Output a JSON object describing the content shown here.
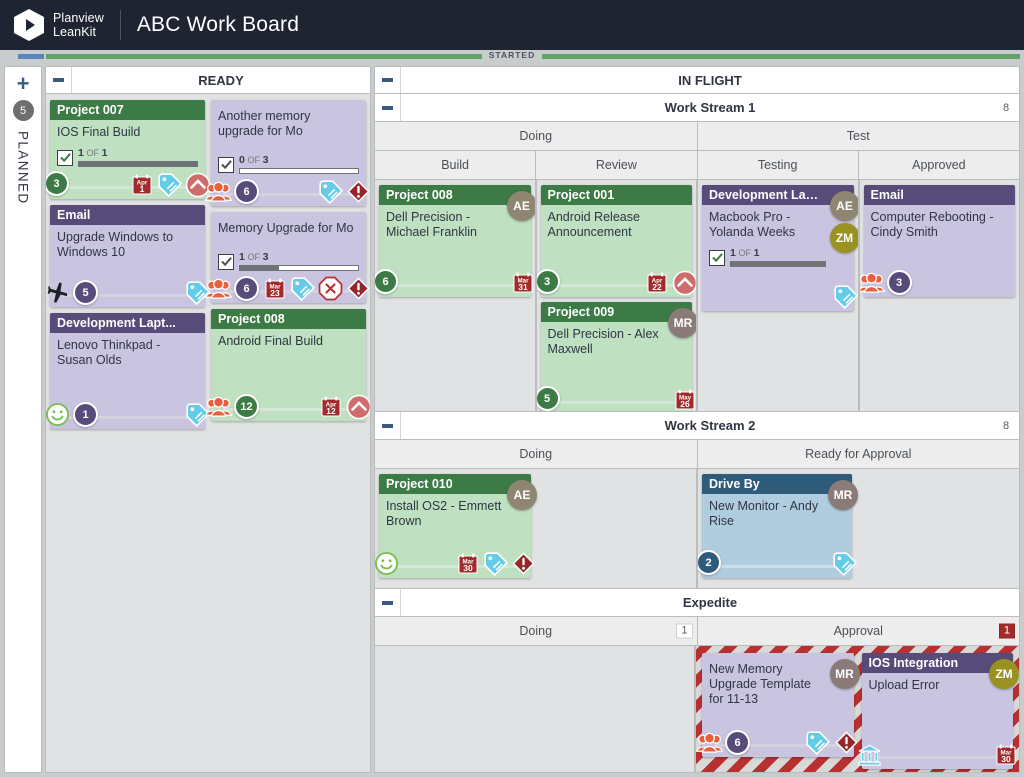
{
  "header": {
    "logo_line1": "Planview",
    "logo_line2": "LeanKit",
    "board_title": "ABC Work Board"
  },
  "divider": {
    "started_label": "STARTED"
  },
  "sidebar": {
    "add_label": "+",
    "count": "5",
    "lane_label": "PLANNED"
  },
  "lanes": {
    "ready": {
      "title": "READY"
    },
    "in_flight": {
      "title": "IN FLIGHT"
    },
    "work_stream_1": {
      "title": "Work Stream 1",
      "count": "8"
    },
    "work_stream_2": {
      "title": "Work Stream 2",
      "count": "8"
    },
    "expedite": {
      "title": "Expedite",
      "count": ""
    }
  },
  "columns": {
    "ws1_doing": "Doing",
    "ws1_test": "Test",
    "ws1_build": "Build",
    "ws1_review": "Review",
    "ws1_testing": "Testing",
    "ws1_approved": "Approved",
    "ws2_doing": "Doing",
    "ws2_ready_approval": "Ready for Approval",
    "ex_doing": "Doing",
    "ex_doing_count": "1",
    "ex_approval": "Approval",
    "ex_approval_count": "1"
  },
  "cards": {
    "project007": {
      "header": "Project 007",
      "title": "IOS Final Build",
      "checklist": {
        "done": "1",
        "of": "OF",
        "total": "1",
        "percent": 100
      },
      "size": "3",
      "date": {
        "month": "Apr",
        "day": "1"
      },
      "icons": [
        "tag-icon",
        "priority-up-icon"
      ]
    },
    "email_upgrade": {
      "header": "Email",
      "title": "Upgrade Windows to Windows 10",
      "size": "5",
      "icons": [
        "plane-icon",
        "tag-icon"
      ]
    },
    "dev_laptop_lenovo": {
      "header": "Development Lapt...",
      "title": "Lenovo Thinkpad - Susan Olds",
      "size": "1",
      "icons": [
        "smiley-icon",
        "tag-icon"
      ]
    },
    "another_memory": {
      "header": "",
      "title": "Another memory upgrade for Mo",
      "checklist": {
        "done": "0",
        "of": "OF",
        "total": "3",
        "percent": 0
      },
      "size": "6",
      "icons": [
        "people-icon",
        "tag-icon",
        "alert-icon"
      ]
    },
    "memory_upgrade_mo": {
      "header": "",
      "title": "Memory Upgrade for Mo",
      "checklist": {
        "done": "1",
        "of": "OF",
        "total": "3",
        "percent": 33
      },
      "size": "6",
      "date": {
        "month": "Mar",
        "day": "23"
      },
      "icons": [
        "people-icon",
        "tag-icon",
        "blocked-icon",
        "alert-icon"
      ]
    },
    "project008_ready": {
      "header": "Project 008",
      "title": "Android Final Build",
      "size": "12",
      "date": {
        "month": "Apr",
        "day": "12"
      },
      "icons": [
        "people-icon",
        "priority-up-icon"
      ]
    },
    "project008_build": {
      "header": "Project 008",
      "title": "Dell Precision - Michael Franklin",
      "size": "6",
      "date": {
        "month": "Mar",
        "day": "31"
      },
      "avatars": [
        {
          "initials": "AE",
          "color": "#8e8573"
        }
      ]
    },
    "project001": {
      "header": "Project 001",
      "title": "Android Release Announcement",
      "size": "3",
      "date": {
        "month": "Apr",
        "day": "22"
      },
      "icons": [
        "priority-up-icon"
      ]
    },
    "project009": {
      "header": "Project 009",
      "title": "Dell Precision - Alex Maxwell",
      "size": "5",
      "date": {
        "month": "May",
        "day": "26"
      },
      "avatars": [
        {
          "initials": "MR",
          "color": "#8b7b78"
        }
      ]
    },
    "dev_laptop_macbook": {
      "header": "Development Lapt...",
      "title": "Macbook Pro - Yolanda Weeks",
      "checklist": {
        "done": "1",
        "of": "OF",
        "total": "1",
        "percent": 100
      },
      "avatars": [
        {
          "initials": "AE",
          "color": "#8e8573"
        },
        {
          "initials": "ZM",
          "color": "#9a9220"
        }
      ],
      "icons": [
        "tag-icon"
      ]
    },
    "email_rebooting": {
      "header": "Email",
      "title": "Computer Rebooting - Cindy Smith",
      "size": "3",
      "icons": [
        "people-icon"
      ]
    },
    "project010": {
      "header": "Project 010",
      "title": "Install OS2 - Emmett Brown",
      "date": {
        "month": "Mar",
        "day": "30"
      },
      "avatars": [
        {
          "initials": "AE",
          "color": "#8e8573"
        }
      ],
      "icons": [
        "smiley-icon",
        "tag-icon",
        "alert-icon"
      ]
    },
    "drive_by": {
      "header": "Drive By",
      "title": "New Monitor - Andy Rise",
      "size": "2",
      "avatars": [
        {
          "initials": "MR",
          "color": "#8b7b78"
        }
      ],
      "icons": [
        "tag-icon"
      ]
    },
    "new_memory_template": {
      "header": "",
      "title": "New Memory Upgrade Template for 11-13",
      "size": "6",
      "avatars": [
        {
          "initials": "MR",
          "color": "#8b7b78"
        }
      ],
      "icons": [
        "people-icon",
        "tag-icon",
        "alert-icon"
      ]
    },
    "ios_integration": {
      "header": "IOS Integration",
      "title": "Upload Error",
      "date": {
        "month": "Mar",
        "day": "30"
      },
      "avatars": [
        {
          "initials": "ZM",
          "color": "#9a9220"
        }
      ],
      "icons": [
        "bank-icon"
      ]
    }
  },
  "colors": {
    "brand_dark": "#1f2433",
    "green_card_header": "#3c7a46",
    "purple_card_header": "#574b79",
    "blue_card_header": "#2f5b7a",
    "accent_blue": "#3b5a80",
    "tag_icon": "#64cbe8",
    "alert_red": "#a32a2a",
    "striped_red": "#b83030"
  }
}
